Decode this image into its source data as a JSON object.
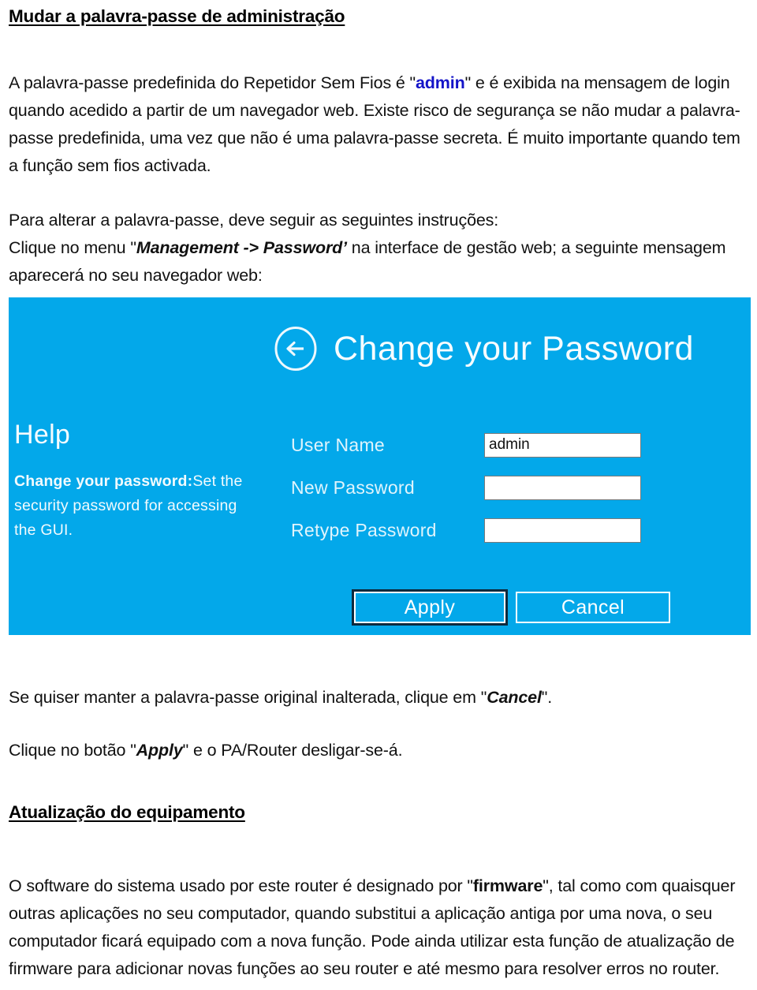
{
  "document": {
    "heading_password": "Mudar a palavra-passe de administração",
    "heading_firmware": "Atualização do equipamento",
    "para_intro_pre": "A palavra-passe predefinida do Repetidor Sem Fios é \"",
    "para_intro_highlight": "admin",
    "para_intro_post": "\" e é exibida na mensagem de login quando acedido a partir de um navegador web. Existe risco de segurança se não mudar a palavra-passe predefinida, uma vez que não é uma palavra-passe secreta. É muito importante quando tem a função sem fios activada.",
    "para_steps_line1": "Para alterar a palavra-passe, deve seguir as seguintes instruções:",
    "para_steps_line2_pre": "Clique no menu \"",
    "para_steps_menu_path": "Management -> Password’",
    "para_steps_line2_post": " na interface de gestão web; a seguinte mensagem aparecerá no seu navegador web:",
    "para_cancel_pre": "Se quiser manter a palavra-passe original inalterada, clique em \"",
    "para_cancel_emphasis": "Cancel",
    "para_cancel_post": "\".",
    "para_apply_pre": "Clique no botão \"",
    "para_apply_emphasis": "Apply",
    "para_apply_post": "\" e o PA/Router desligar-se-á.",
    "para_firmware_pre": "O software do sistema usado por este router é designado por \"",
    "para_firmware_emphasis": "firmware",
    "para_firmware_post": "\", tal como com quaisquer outras aplicações no seu computador, quando substitui a aplicação antiga por uma nova, o seu computador ficará equipado com a nova função. Pode ainda utilizar esta função de atualização de firmware para adicionar novas funções ao seu router e até mesmo para resolver erros no router."
  },
  "router_ui": {
    "title": "Change your Password",
    "back_icon": "circled-left-arrow-icon",
    "help": {
      "title": "Help",
      "bold_lead": "Change your password:",
      "body": "Set the security password for accessing the GUI."
    },
    "fields": [
      {
        "label": "User Name",
        "value": "admin",
        "placeholder": "",
        "type": "text"
      },
      {
        "label": "New Password",
        "value": "",
        "placeholder": "",
        "type": "password"
      },
      {
        "label": "Retype Password",
        "value": "",
        "placeholder": "",
        "type": "password"
      }
    ],
    "buttons": {
      "apply": "Apply",
      "cancel": "Cancel"
    },
    "colors": {
      "panel_background": "#03a8ea",
      "text_on_panel": "#ffffff",
      "input_background": "#ffffff",
      "apply_focus_ring": "#0d2a3e"
    }
  },
  "colors": {
    "page_background": "#ffffff",
    "body_text": "#111111",
    "highlight_blue": "#1414c8"
  }
}
